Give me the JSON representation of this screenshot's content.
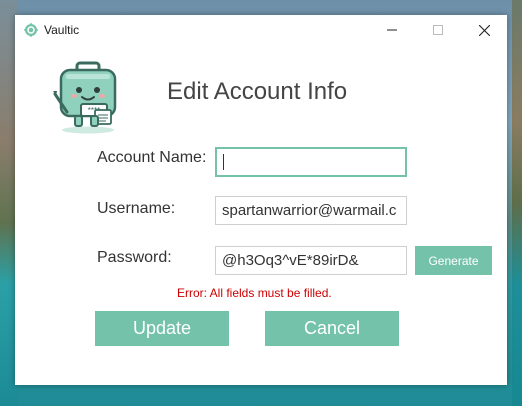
{
  "window": {
    "title": "Vaultic",
    "controls": {
      "minimize": "—",
      "maximize": "☐",
      "close": "✕"
    }
  },
  "dialog": {
    "heading": "Edit Account Info",
    "fields": {
      "account_name": {
        "label": "Account Name:",
        "value": ""
      },
      "username": {
        "label": "Username:",
        "value": "spartanwarrior@warmail.c"
      },
      "password": {
        "label": "Password:",
        "value": "@h3Oq3^vE*89irD&"
      }
    },
    "generate_label": "Generate",
    "error": "Error: All fields must be filled.",
    "update_label": "Update",
    "cancel_label": "Cancel"
  },
  "icons": {
    "app": "vaultic-logo-icon",
    "mascot": "vault-mascot-icon"
  },
  "colors": {
    "accent": "#74c2a9",
    "error": "#cc0000",
    "heading": "#444444"
  }
}
